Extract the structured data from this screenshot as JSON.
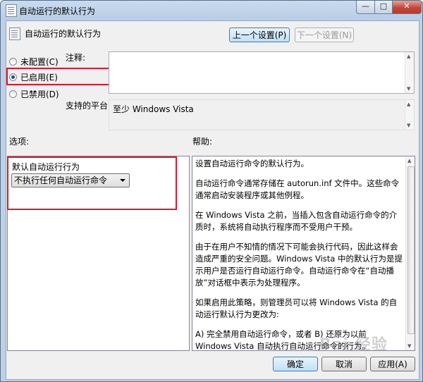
{
  "window": {
    "title": "自动运行的默认行为"
  },
  "header": {
    "policy_title": "自动运行的默认行为",
    "prev_button": "上一个设置(P)",
    "next_button": "下一个设置(N)"
  },
  "state": {
    "options": [
      {
        "label": "未配置(C)",
        "selected": false
      },
      {
        "label": "已启用(E)",
        "selected": true
      },
      {
        "label": "已禁用(D)",
        "selected": false
      }
    ],
    "comment_label": "注释:",
    "comment_value": "",
    "platform_label": "支持的平台:",
    "platform_value": "至少 Windows Vista"
  },
  "options_section": {
    "label": "选项:",
    "field_label": "默认自动运行行为",
    "selected_value": "不执行任何自动运行命令"
  },
  "help_section": {
    "label": "帮助:",
    "paragraphs": [
      "设置自动运行命令的默认行为。",
      "自动运行命令通常存储在 autorun.inf 文件中。这些命令通常启动安装程序或其他例程。",
      "在 Windows Vista 之前，当插入包含自动运行命令的介质时，系统将自动执行程序而不受用户干预。",
      "由于在用户不知情的情况下可能会执行代码，因此这样会造成严重的安全问题。Windows Vista 中的默认行为是提示用户是否运行自动运行命令。自动运行命令在“自动播放”对话框中表示为处理程序。",
      "如果启用此策略，则管理员可以将 Windows Vista 的自动运行默认行为更改为:",
      "A) 完全禁用自动运行命令，或者 B) 还原为以前 Windows Vista 自动执行自动运行命令的行为。"
    ]
  },
  "footer": {
    "ok": "确定",
    "cancel": "取消",
    "apply": "应用(A)"
  },
  "watermark": "Bai 经验",
  "colors": {
    "highlight": "#e0162b",
    "primary_button": "#bfe0f7",
    "selected_radio": "#1d4f8b"
  }
}
